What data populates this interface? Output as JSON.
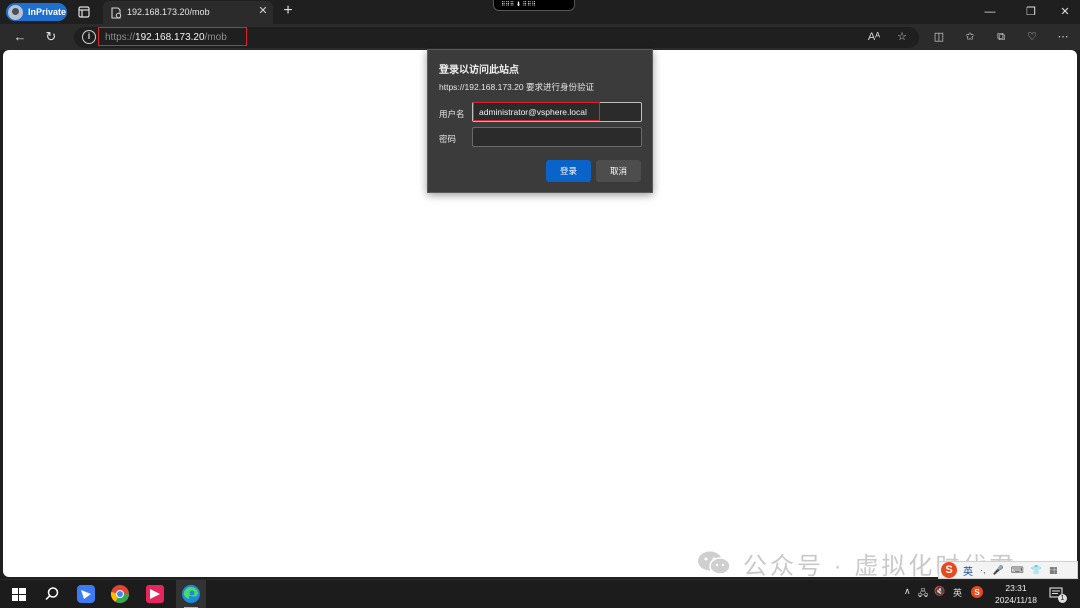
{
  "browser": {
    "profile_label": "InPrivate",
    "tab_title": "192.168.173.20/mob",
    "url_scheme": "https://",
    "url_host": "192.168.173.20",
    "url_path": "/mob"
  },
  "dialog": {
    "title": "登录以访问此站点",
    "subtitle": "https://192.168.173.20 要求进行身份验证",
    "username_label": "用户名",
    "username_value": "administrator@vsphere.local",
    "password_label": "密码",
    "password_value": "",
    "login_label": "登录",
    "cancel_label": "取消"
  },
  "watermark": {
    "text": "公众号 · 虚拟化时代君"
  },
  "ime": {
    "lang": "英"
  },
  "taskbar": {
    "tray_lang": "英",
    "time": "23:31",
    "date": "2024/11/18",
    "notification_count": "1"
  },
  "colors": {
    "accent": "#0a63c9",
    "highlight": "#e0222a",
    "inprivate": "#1f6fd1"
  }
}
